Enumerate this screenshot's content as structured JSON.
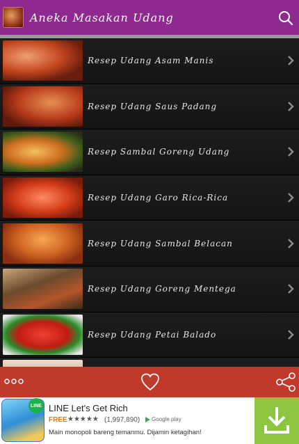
{
  "appbar": {
    "title": "Aneka Masakan Udang",
    "icon": "app-logo-shrimp-dish",
    "search_icon": "search-icon",
    "color": "#8e2a8f"
  },
  "recipes": [
    {
      "label": "Resep Udang Asam Manis"
    },
    {
      "label": "Resep Udang Saus Padang"
    },
    {
      "label": "Resep Sambal Goreng Udang"
    },
    {
      "label": "Resep Udang Garo Rica-Rica"
    },
    {
      "label": "Resep Udang Sambal Belacan"
    },
    {
      "label": "Resep Udang Goreng Mentega"
    },
    {
      "label": "Resep Udang Petai Balado"
    },
    {
      "label": ""
    }
  ],
  "bottombar": {
    "color": "#c0392b",
    "icons": [
      "more-icon",
      "heart-icon",
      "share-icon"
    ]
  },
  "ad": {
    "title": "LINE Let's Get Rich",
    "price": "FREE",
    "stars": "★★★★★",
    "rating_count": "(1,997,890)",
    "store": "Google play",
    "description": "Main monopoli bareng temanmu. Dijamin ketagihan!",
    "badge": "LINE",
    "download_color": "#8cc63f"
  }
}
